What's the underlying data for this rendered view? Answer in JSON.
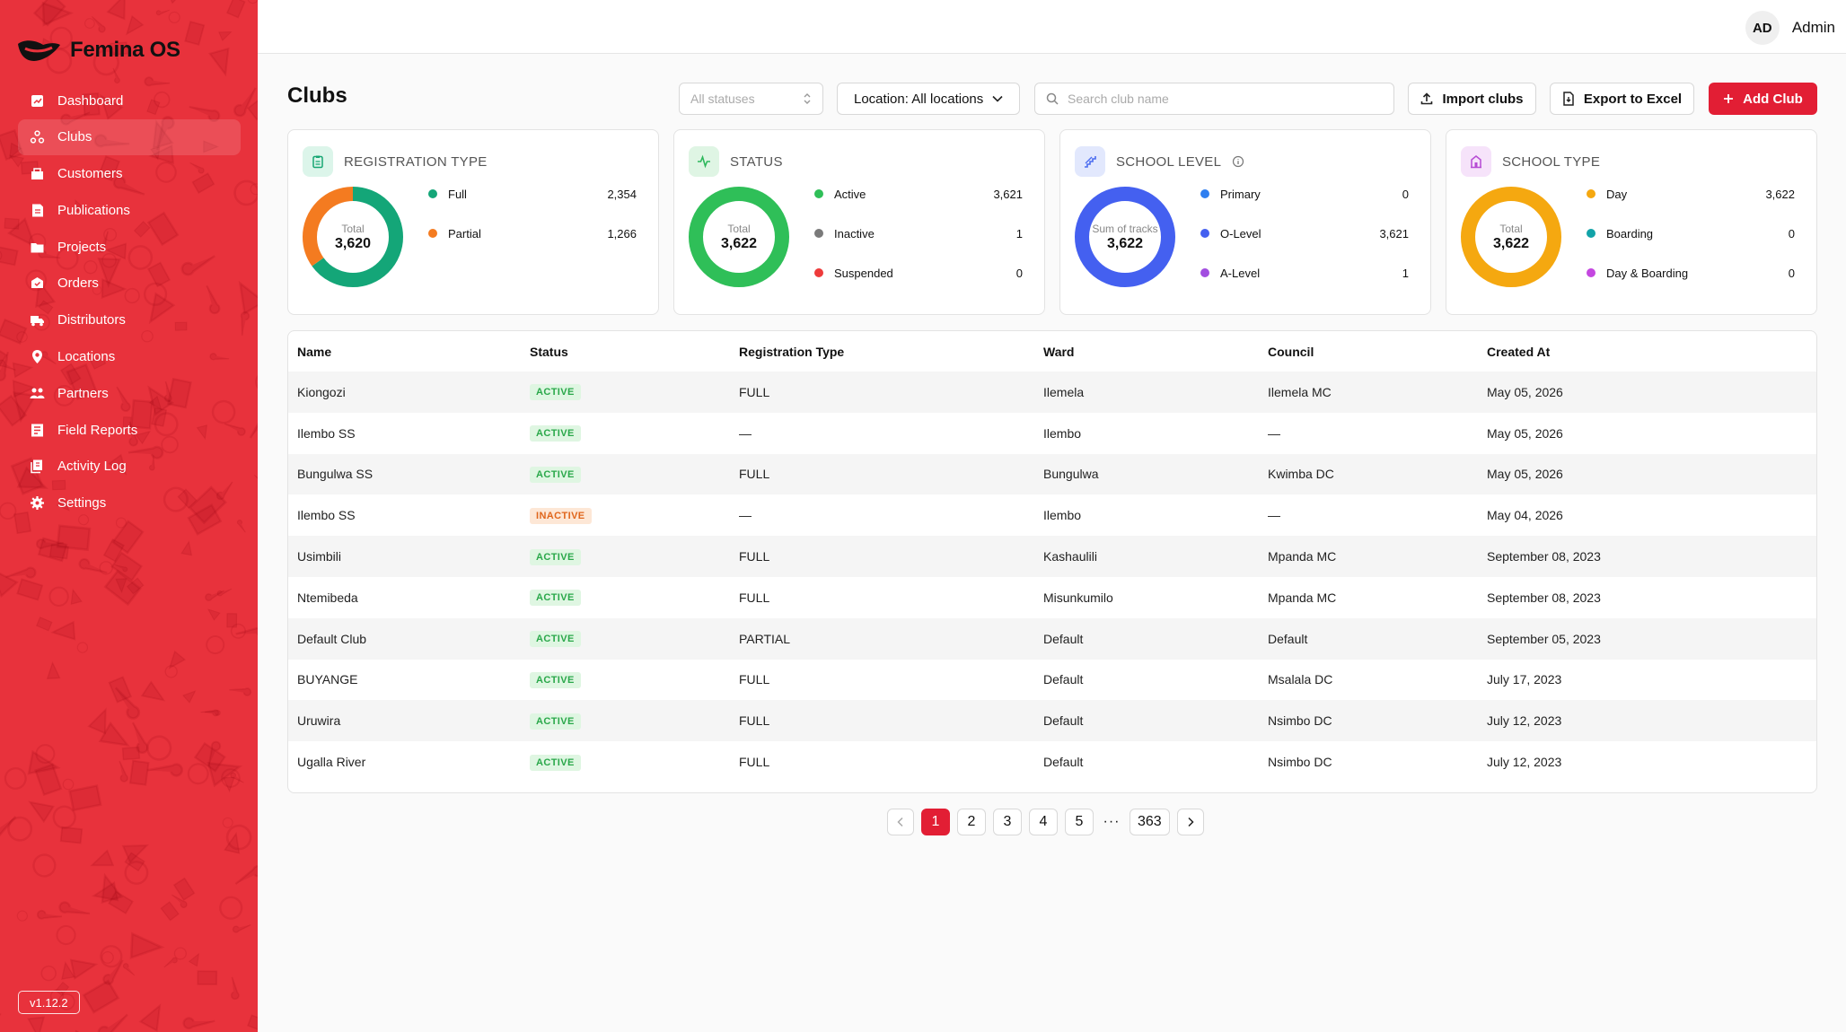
{
  "app": {
    "name": "Femina OS",
    "version": "v1.12.2"
  },
  "sidebar": {
    "items": [
      {
        "label": "Dashboard",
        "icon": "dashboard-icon"
      },
      {
        "label": "Clubs",
        "icon": "clubs-icon",
        "active": true
      },
      {
        "label": "Customers",
        "icon": "customers-icon"
      },
      {
        "label": "Publications",
        "icon": "publications-icon"
      },
      {
        "label": "Projects",
        "icon": "projects-icon"
      },
      {
        "label": "Orders",
        "icon": "orders-icon"
      },
      {
        "label": "Distributors",
        "icon": "distributors-icon"
      },
      {
        "label": "Locations",
        "icon": "locations-icon"
      },
      {
        "label": "Partners",
        "icon": "partners-icon"
      },
      {
        "label": "Field Reports",
        "icon": "field-reports-icon"
      },
      {
        "label": "Activity Log",
        "icon": "activity-log-icon"
      },
      {
        "label": "Settings",
        "icon": "settings-icon"
      }
    ]
  },
  "user": {
    "initials": "AD",
    "name": "Admin"
  },
  "page": {
    "title": "Clubs"
  },
  "toolbar": {
    "status_placeholder": "All statuses",
    "location_label": "Location: All locations",
    "search_placeholder": "Search club name",
    "import_label": "Import clubs",
    "export_label": "Export to Excel",
    "add_label": "Add Club"
  },
  "colors": {
    "accent": "#e21e34",
    "sidebar": "#e8323c"
  },
  "cards": [
    {
      "title": "REGISTRATION TYPE",
      "icon": "clipboard-icon",
      "icon_bg": "#dcf5ea",
      "icon_color": "#17a673",
      "center_label": "Total",
      "center_value": "3,620",
      "items": [
        {
          "label": "Full",
          "value": "2,354",
          "color": "#14a678"
        },
        {
          "label": "Partial",
          "value": "1,266",
          "color": "#f47b20"
        }
      ]
    },
    {
      "title": "STATUS",
      "icon": "pulse-icon",
      "icon_bg": "#dff5e4",
      "icon_color": "#2eb85c",
      "center_label": "Total",
      "center_value": "3,622",
      "items": [
        {
          "label": "Active",
          "value": "3,621",
          "color": "#2fbf58"
        },
        {
          "label": "Inactive",
          "value": "1",
          "color": "#7a7a7a"
        },
        {
          "label": "Suspended",
          "value": "0",
          "color": "#ee3b3b"
        }
      ]
    },
    {
      "title": "SCHOOL LEVEL",
      "icon": "stairs-icon",
      "icon_bg": "#e2e8fd",
      "icon_color": "#4a6cf0",
      "has_info": true,
      "center_label": "Sum of tracks",
      "center_value": "3,622",
      "items": [
        {
          "label": "Primary",
          "value": "0",
          "color": "#2f7ff0"
        },
        {
          "label": "O-Level",
          "value": "3,621",
          "color": "#4460f0"
        },
        {
          "label": "A-Level",
          "value": "1",
          "color": "#a24ee0"
        }
      ]
    },
    {
      "title": "SCHOOL TYPE",
      "icon": "building-icon",
      "icon_bg": "#f6e3fa",
      "icon_color": "#b64bd4",
      "center_label": "Total",
      "center_value": "3,622",
      "items": [
        {
          "label": "Day",
          "value": "3,622",
          "color": "#f5a810"
        },
        {
          "label": "Boarding",
          "value": "0",
          "color": "#12a3a8"
        },
        {
          "label": "Day & Boarding",
          "value": "0",
          "color": "#c447e0"
        }
      ]
    }
  ],
  "table": {
    "columns": [
      "Name",
      "Status",
      "Registration Type",
      "Ward",
      "Council",
      "Created At"
    ],
    "rows": [
      {
        "name": "Kiongozi",
        "status": "ACTIVE",
        "reg": "FULL",
        "ward": "Ilemela",
        "council": "Ilemela MC",
        "created": "May 05, 2026"
      },
      {
        "name": "Ilembo SS",
        "status": "ACTIVE",
        "reg": "—",
        "ward": "Ilembo",
        "council": "—",
        "created": "May 05, 2026"
      },
      {
        "name": "Bungulwa SS",
        "status": "ACTIVE",
        "reg": "FULL",
        "ward": "Bungulwa",
        "council": "Kwimba DC",
        "created": "May 05, 2026"
      },
      {
        "name": "Ilembo SS",
        "status": "INACTIVE",
        "reg": "—",
        "ward": "Ilembo",
        "council": "—",
        "created": "May 04, 2026"
      },
      {
        "name": "Usimbili",
        "status": "ACTIVE",
        "reg": "FULL",
        "ward": "Kashaulili",
        "council": "Mpanda MC",
        "created": "September 08, 2023"
      },
      {
        "name": "Ntemibeda",
        "status": "ACTIVE",
        "reg": "FULL",
        "ward": "Misunkumilo",
        "council": "Mpanda MC",
        "created": "September 08, 2023"
      },
      {
        "name": "Default Club",
        "status": "ACTIVE",
        "reg": "PARTIAL",
        "ward": "Default",
        "council": "Default",
        "created": "September 05, 2023"
      },
      {
        "name": "BUYANGE",
        "status": "ACTIVE",
        "reg": "FULL",
        "ward": "Default",
        "council": "Msalala DC",
        "created": "July 17, 2023"
      },
      {
        "name": "Uruwira",
        "status": "ACTIVE",
        "reg": "FULL",
        "ward": "Default",
        "council": "Nsimbo DC",
        "created": "July 12, 2023"
      },
      {
        "name": "Ugalla River",
        "status": "ACTIVE",
        "reg": "FULL",
        "ward": "Default",
        "council": "Nsimbo DC",
        "created": "July 12, 2023"
      }
    ]
  },
  "pagination": {
    "pages": [
      "1",
      "2",
      "3",
      "4",
      "5"
    ],
    "ellipsis": "···",
    "last": "363",
    "current": "1"
  }
}
